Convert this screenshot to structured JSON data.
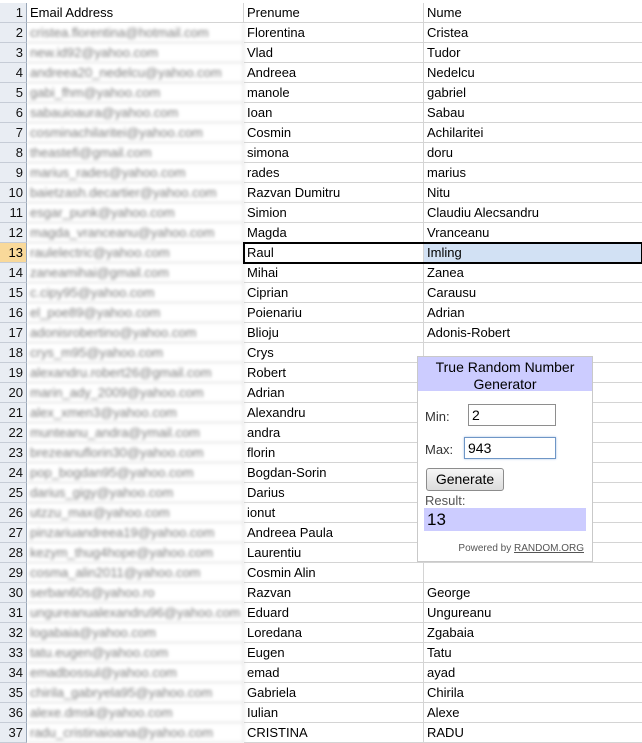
{
  "sheet": {
    "selected_row": 13,
    "rows": [
      {
        "n": "1",
        "email": "Email Address",
        "prenume": "Prenume",
        "nume": "Nume"
      },
      {
        "n": "2",
        "email": "cristea.florentina@hotmail.com",
        "prenume": "Florentina",
        "nume": "Cristea"
      },
      {
        "n": "3",
        "email": "new.id92@yahoo.com",
        "prenume": "Vlad",
        "nume": "Tudor"
      },
      {
        "n": "4",
        "email": "andreea20_nedelcu@yahoo.com",
        "prenume": "Andreea",
        "nume": "Nedelcu"
      },
      {
        "n": "5",
        "email": "gabi_fhm@yahoo.com",
        "prenume": "manole",
        "nume": "gabriel"
      },
      {
        "n": "6",
        "email": "sabauioaura@yahoo.com",
        "prenume": "Ioan",
        "nume": "Sabau"
      },
      {
        "n": "7",
        "email": "cosminachilaritei@yahoo.com",
        "prenume": "Cosmin",
        "nume": "Achilaritei"
      },
      {
        "n": "8",
        "email": "theastefi@gmail.com",
        "prenume": "simona",
        "nume": "doru"
      },
      {
        "n": "9",
        "email": "marius_rades@yahoo.com",
        "prenume": "rades",
        "nume": "marius"
      },
      {
        "n": "10",
        "email": "baietzash.decartier@yahoo.com",
        "prenume": "Razvan Dumitru",
        "nume": "Nitu"
      },
      {
        "n": "11",
        "email": "esgar_punk@yahoo.com",
        "prenume": "Simion",
        "nume": "Claudiu Alecsandru"
      },
      {
        "n": "12",
        "email": "magda_vranceanu@yahoo.com",
        "prenume": "Magda",
        "nume": "Vranceanu"
      },
      {
        "n": "13",
        "email": "raulelectric@yahoo.com",
        "prenume": "Raul",
        "nume": "Imling"
      },
      {
        "n": "14",
        "email": "zaneamihai@gmail.com",
        "prenume": "Mihai",
        "nume": "Zanea"
      },
      {
        "n": "15",
        "email": "c.cipy95@yahoo.com",
        "prenume": "Ciprian",
        "nume": "Carausu"
      },
      {
        "n": "16",
        "email": "el_poe89@yahoo.com",
        "prenume": "Poienariu",
        "nume": "Adrian"
      },
      {
        "n": "17",
        "email": "adonisrobertino@yahoo.com",
        "prenume": "Blioju",
        "nume": "Adonis-Robert"
      },
      {
        "n": "18",
        "email": "crys_m95@yahoo.com",
        "prenume": "Crys",
        "nume": ""
      },
      {
        "n": "19",
        "email": "alexandru.robert26@gmail.com",
        "prenume": "Robert",
        "nume": ""
      },
      {
        "n": "20",
        "email": "marin_ady_2009@yahoo.com",
        "prenume": "Adrian",
        "nume": ""
      },
      {
        "n": "21",
        "email": "alex_xmen3@yahoo.com",
        "prenume": "Alexandru",
        "nume": ""
      },
      {
        "n": "22",
        "email": "munteanu_andra@ymail.com",
        "prenume": "andra",
        "nume": ""
      },
      {
        "n": "23",
        "email": "brezeanuflorin30@yahoo.com",
        "prenume": "florin",
        "nume": ""
      },
      {
        "n": "24",
        "email": "pop_bogdan95@yahoo.com",
        "prenume": "Bogdan-Sorin",
        "nume": ""
      },
      {
        "n": "25",
        "email": "darius_gigy@yahoo.com",
        "prenume": "Darius",
        "nume": ""
      },
      {
        "n": "26",
        "email": "utzzu_max@yahoo.com",
        "prenume": "ionut",
        "nume": ""
      },
      {
        "n": "27",
        "email": "pinzariuandreea19@yahoo.com",
        "prenume": "Andreea Paula",
        "nume": ""
      },
      {
        "n": "28",
        "email": "kezym_thug4hope@yahoo.com",
        "prenume": "Laurentiu",
        "nume": ""
      },
      {
        "n": "29",
        "email": "cosma_alin2011@yahoo.com",
        "prenume": "Cosmin Alin",
        "nume": ""
      },
      {
        "n": "30",
        "email": "serban60s@yahoo.ro",
        "prenume": "Razvan",
        "nume": "George"
      },
      {
        "n": "31",
        "email": "ungureanualexandru96@yahoo.com",
        "prenume": "Eduard",
        "nume": "Ungureanu"
      },
      {
        "n": "32",
        "email": "logabaia@yahoo.com",
        "prenume": "Loredana",
        "nume": "Zgabaia"
      },
      {
        "n": "33",
        "email": "tatu.eugen@yahoo.com",
        "prenume": "Eugen",
        "nume": "Tatu"
      },
      {
        "n": "34",
        "email": "emadbossul@yahoo.com",
        "prenume": "emad",
        "nume": "ayad"
      },
      {
        "n": "35",
        "email": "chirila_gabryela95@yahoo.com",
        "prenume": "Gabriela",
        "nume": "Chirila"
      },
      {
        "n": "36",
        "email": "alexe.dmsk@yahoo.com",
        "prenume": "Iulian",
        "nume": "Alexe"
      },
      {
        "n": "37",
        "email": "radu_cristinaioana@yahoo.com",
        "prenume": "CRISTINA",
        "nume": "RADU"
      }
    ]
  },
  "rng_widget": {
    "title": "True Random Number Generator",
    "min_label": "Min:",
    "min_value": "2",
    "max_label": "Max:",
    "max_value": "943",
    "generate_label": "Generate",
    "result_label": "Result:",
    "result_value": "13",
    "powered_prefix": "Powered by",
    "powered_link": "RANDOM.ORG",
    "colors": {
      "title_bg": "#ccccff",
      "result_bg": "#ccccff"
    }
  }
}
